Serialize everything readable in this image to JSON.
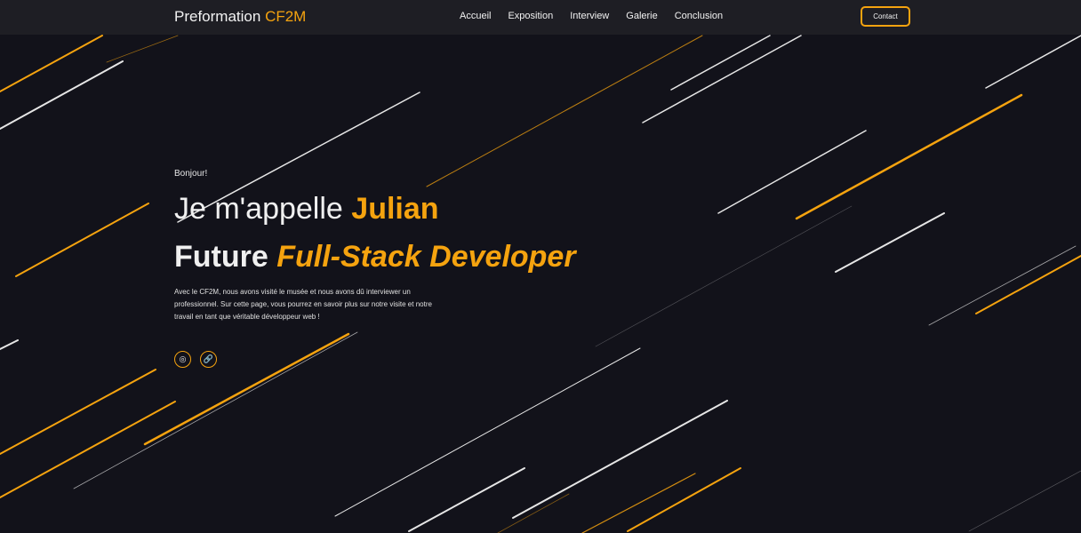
{
  "nav": {
    "brand_main": "Preformation",
    "brand_accent": "CF2M",
    "links": [
      "Accueil",
      "Exposition",
      "Interview",
      "Galerie",
      "Conclusion"
    ],
    "contact_label": "Contact"
  },
  "hero": {
    "greeting": "Bonjour!",
    "line1_prefix": "Je m'appelle",
    "line1_name": "Julian",
    "line2_prefix": "Future",
    "line2_role": "Full-Stack Developer",
    "description": "Avec le CF2M, nous avons visité le musée et nous avons dû interviewer un professionnel. Sur cette page, vous pourrez en savoir plus sur notre visite et notre travail en tant que véritable développeur web !"
  },
  "social": [
    {
      "icon": "github-icon",
      "glyph": "◎"
    },
    {
      "icon": "link-icon",
      "glyph": "🔗"
    }
  ],
  "colors": {
    "background": "#12121a",
    "navbar": "#1e1e24",
    "accent": "#f5a30f",
    "streak_light": "#e6e6e6"
  }
}
